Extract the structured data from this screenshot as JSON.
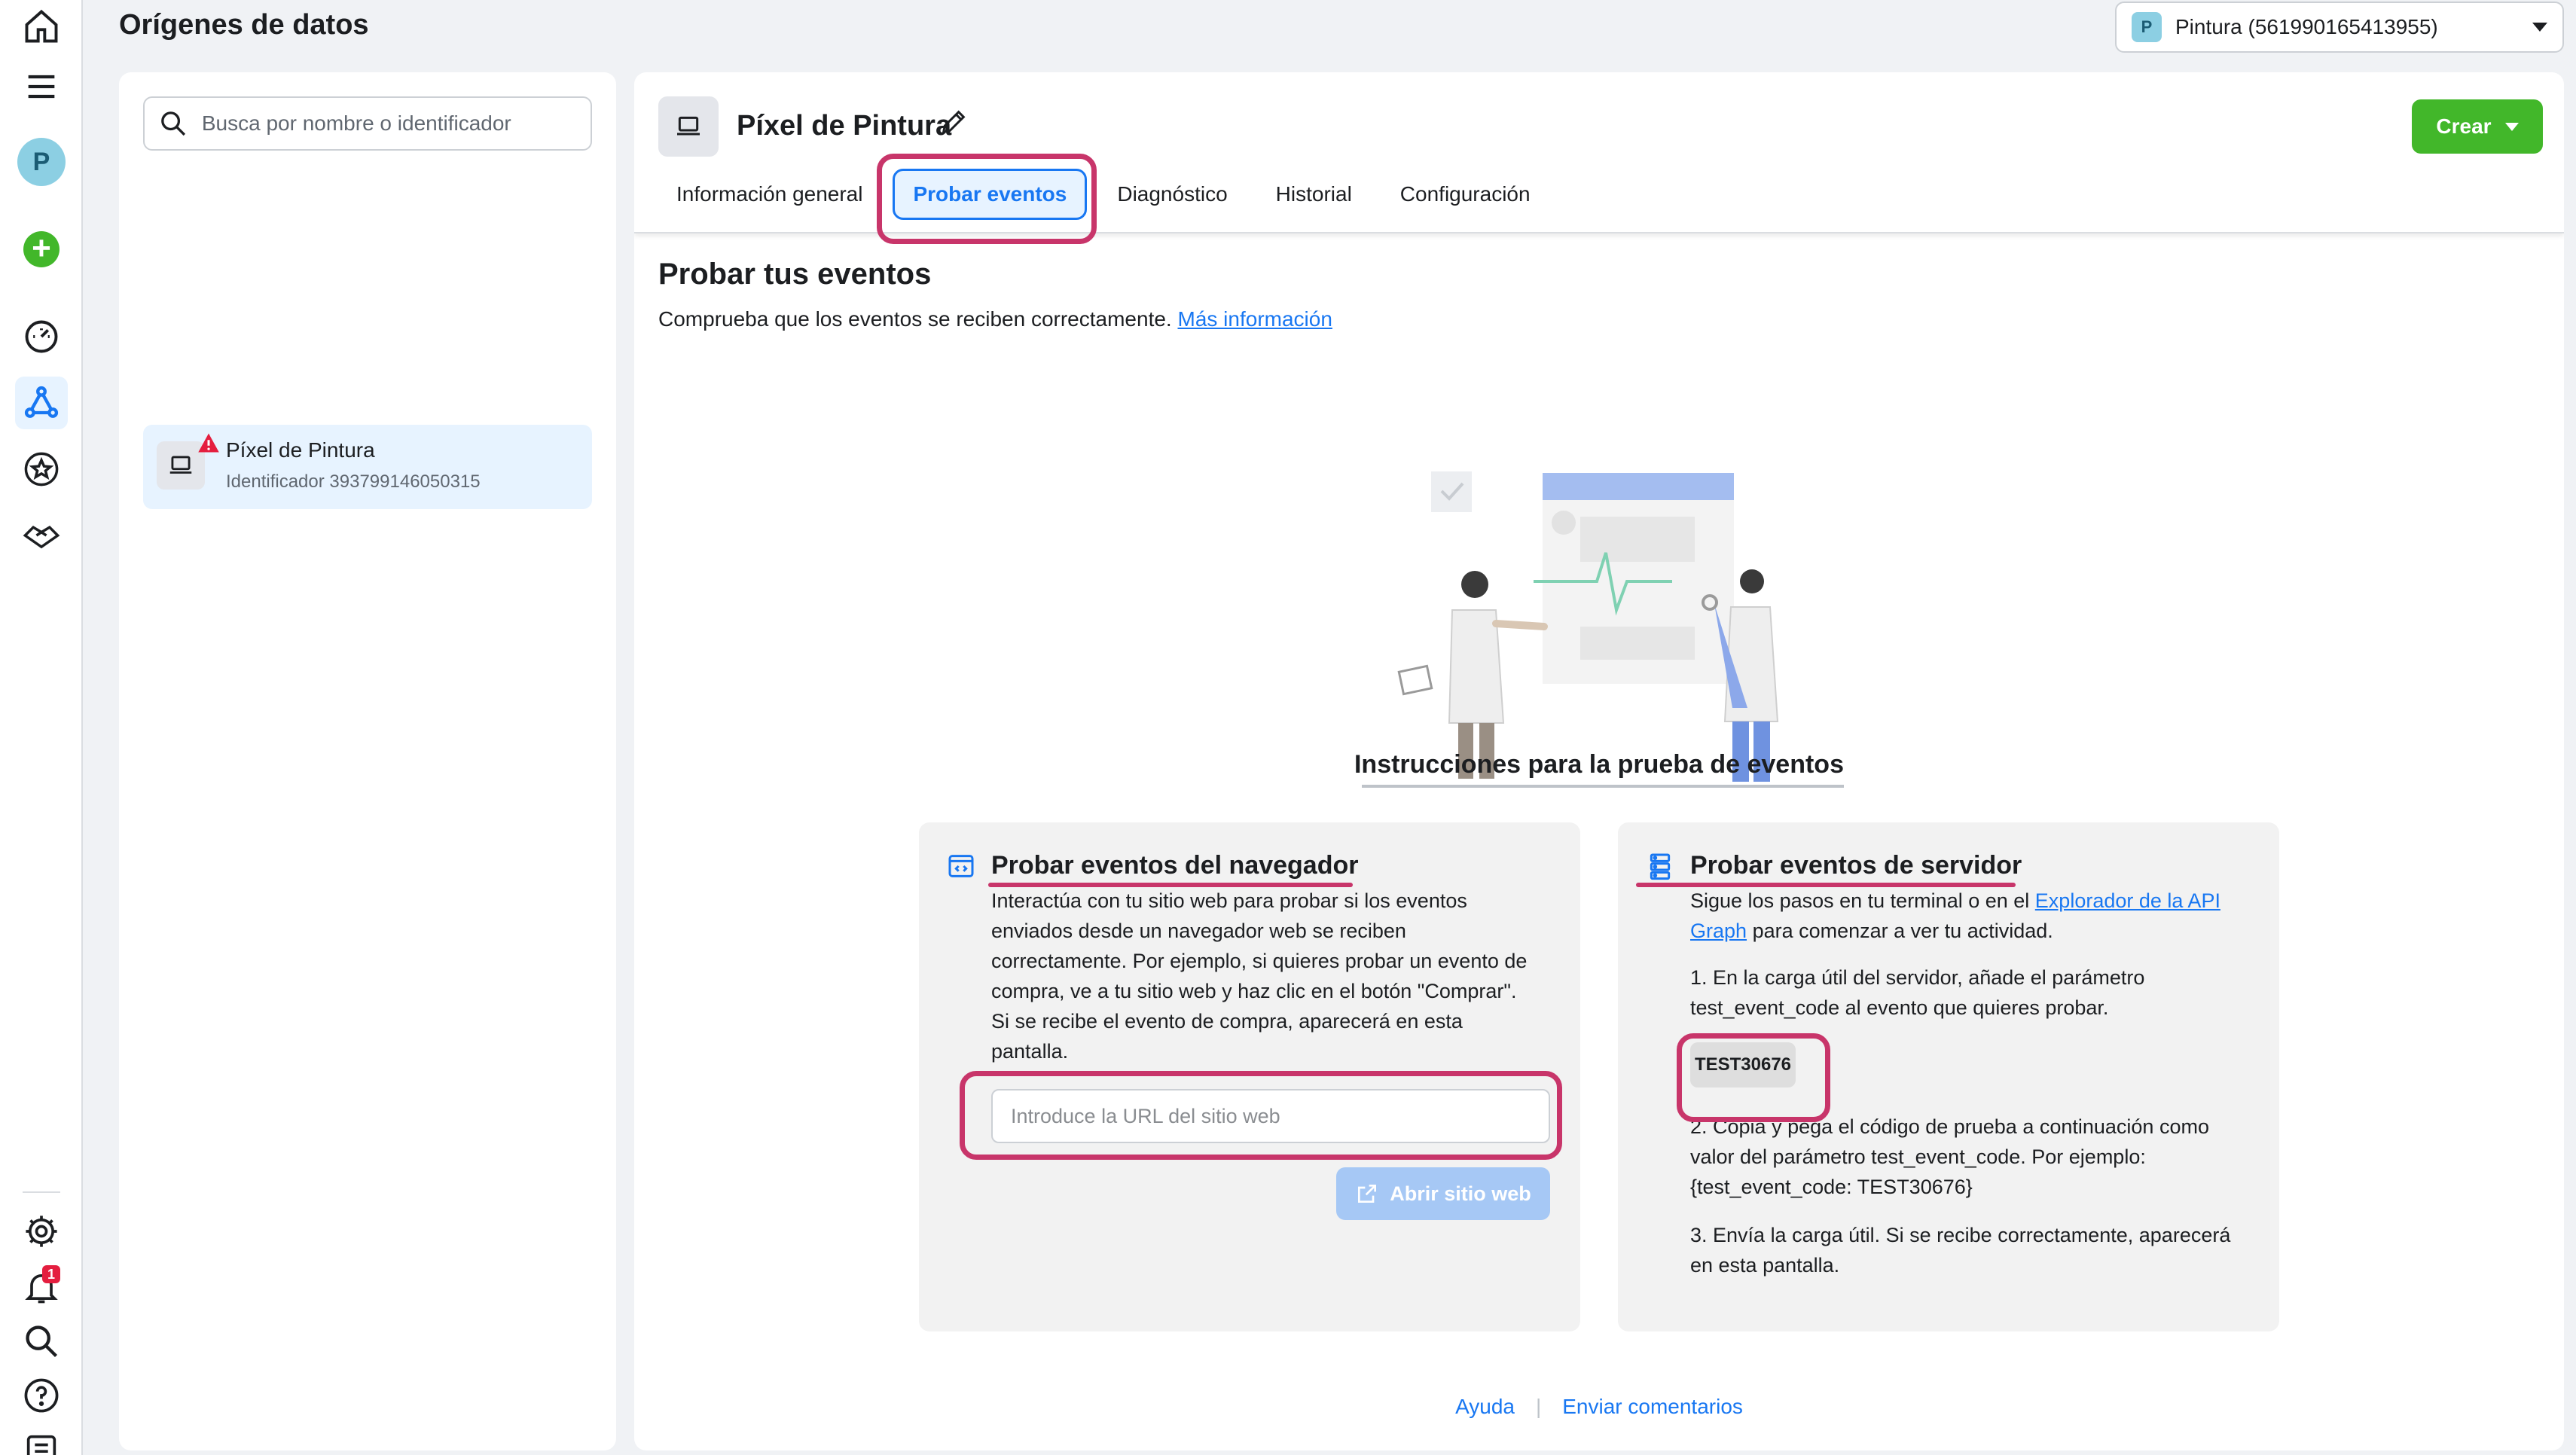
{
  "header": {
    "title": "Orígenes de datos",
    "account_badge": "P",
    "account_label": "Pintura (561990165413955)"
  },
  "rail": {
    "avatar_letter": "P",
    "notification_count": "1"
  },
  "sidebar": {
    "search_placeholder": "Busca por nombre o identificador",
    "items": [
      {
        "name": "Píxel de Pintura",
        "id_text": "Identificador 393799146050315"
      }
    ]
  },
  "main": {
    "pixel_title": "Píxel de Pintura",
    "create_label": "Crear",
    "tabs": [
      {
        "label": "Información general"
      },
      {
        "label": "Probar eventos"
      },
      {
        "label": "Diagnóstico"
      },
      {
        "label": "Historial"
      },
      {
        "label": "Configuración"
      }
    ],
    "section_title": "Probar tus eventos",
    "section_desc": "Comprueba que los eventos se reciben correctamente.",
    "section_link": "Más información",
    "instructions_title": "Instrucciones para la prueba de eventos",
    "browser_card": {
      "title": "Probar eventos del navegador",
      "body_lines": [
        "Interactúa con tu sitio web para probar si los eventos",
        "enviados desde un navegador web se reciben",
        "correctamente. Por ejemplo, si quieres probar un evento de",
        "compra, ve a tu sitio web y haz clic en el botón \"Comprar\".",
        "Si se recibe el evento de compra, aparecerá en esta",
        "pantalla."
      ],
      "url_placeholder": "Introduce la URL del sitio web",
      "open_button": "Abrir sitio web"
    },
    "server_card": {
      "title": "Probar eventos de servidor",
      "intro_line1_pre": "Sigue los pasos en tu terminal o en el",
      "intro_link_1": "Explorador de la API",
      "intro_link_2": "Graph",
      "intro_line2_post": "para comenzar a ver tu actividad.",
      "step1_line1": "1. En la carga útil del servidor, añade el parámetro",
      "step1_line2": "test_event_code al evento que quieres probar.",
      "code": "TEST30676",
      "step2_line1": "2. Copia y pega el código de prueba a continuación como",
      "step2_line2": "valor del parámetro test_event_code. Por ejemplo:",
      "step2_line3": "{test_event_code: TEST30676}",
      "step3_line1": "3. Envía la carga útil. Si se recibe correctamente, aparecerá",
      "step3_line2": "en esta pantalla."
    },
    "footer": {
      "help": "Ayuda",
      "feedback": "Enviar comentarios"
    }
  },
  "colors": {
    "accent": "#1877f2",
    "create": "#42b72a",
    "highlight": "#c8356a"
  }
}
